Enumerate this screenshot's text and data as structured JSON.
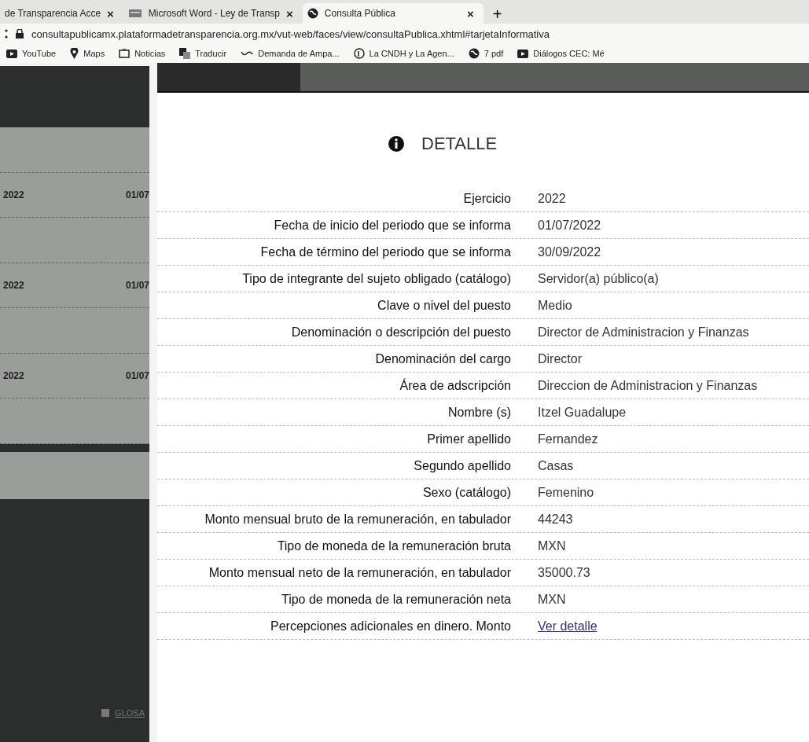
{
  "browser": {
    "tabs": [
      {
        "title": "de Transparencia Acce",
        "selected": false
      },
      {
        "title": "Microsoft Word - Ley de Transp",
        "selected": false
      },
      {
        "title": "Consulta Pública",
        "selected": true
      }
    ],
    "new_tab": "+",
    "close_glyph": "×",
    "url": "consultapublicamx.plataformadetransparencia.org.mx/vut-web/faces/view/consultaPublica.xhtml#tarjetaInformativa",
    "bookmarks": [
      "YouTube",
      "Maps",
      "Noticias",
      "Traducir",
      "Demanda de Ampa...",
      "La CNDH y La Agen...",
      "7 pdf",
      "Diálogos CEC: Mé"
    ]
  },
  "background": {
    "rows": [
      {
        "year": "2022",
        "date": "01/07"
      },
      {
        "year": "2022",
        "date": "01/07"
      },
      {
        "year": "2022",
        "date": "01/07"
      }
    ],
    "footer_link": "GLOSA"
  },
  "modal": {
    "title": "DETALLE",
    "fields": [
      {
        "label": "Ejercicio",
        "value": "2022"
      },
      {
        "label": "Fecha de inicio del periodo que se informa",
        "value": "01/07/2022"
      },
      {
        "label": "Fecha de término del periodo que se informa",
        "value": "30/09/2022"
      },
      {
        "label": "Tipo de integrante del sujeto obligado (catálogo)",
        "value": "Servidor(a) público(a)"
      },
      {
        "label": "Clave o nivel del puesto",
        "value": "Medio"
      },
      {
        "label": "Denominación o descripción del puesto",
        "value": "Director de Administracion y Finanzas"
      },
      {
        "label": "Denominación del cargo",
        "value": "Director"
      },
      {
        "label": "Área de adscripción",
        "value": "Direccion de Administracion y Finanzas"
      },
      {
        "label": "Nombre (s)",
        "value": "Itzel Guadalupe"
      },
      {
        "label": "Primer apellido",
        "value": "Fernandez"
      },
      {
        "label": "Segundo apellido",
        "value": "Casas"
      },
      {
        "label": "Sexo (catálogo)",
        "value": "Femenino"
      },
      {
        "label": "Monto mensual bruto de la remuneración, en tabulador",
        "value": "44243"
      },
      {
        "label": "Tipo de moneda de la remuneración bruta",
        "value": "MXN"
      },
      {
        "label": "Monto mensual neto de la remuneración, en tabulador",
        "value": "35000.73"
      },
      {
        "label": "Tipo de moneda de la remuneración neta",
        "value": "MXN"
      },
      {
        "label": "Percepciones adicionales en dinero. Monto",
        "value": "Ver detalle",
        "kind": "link"
      }
    ]
  }
}
